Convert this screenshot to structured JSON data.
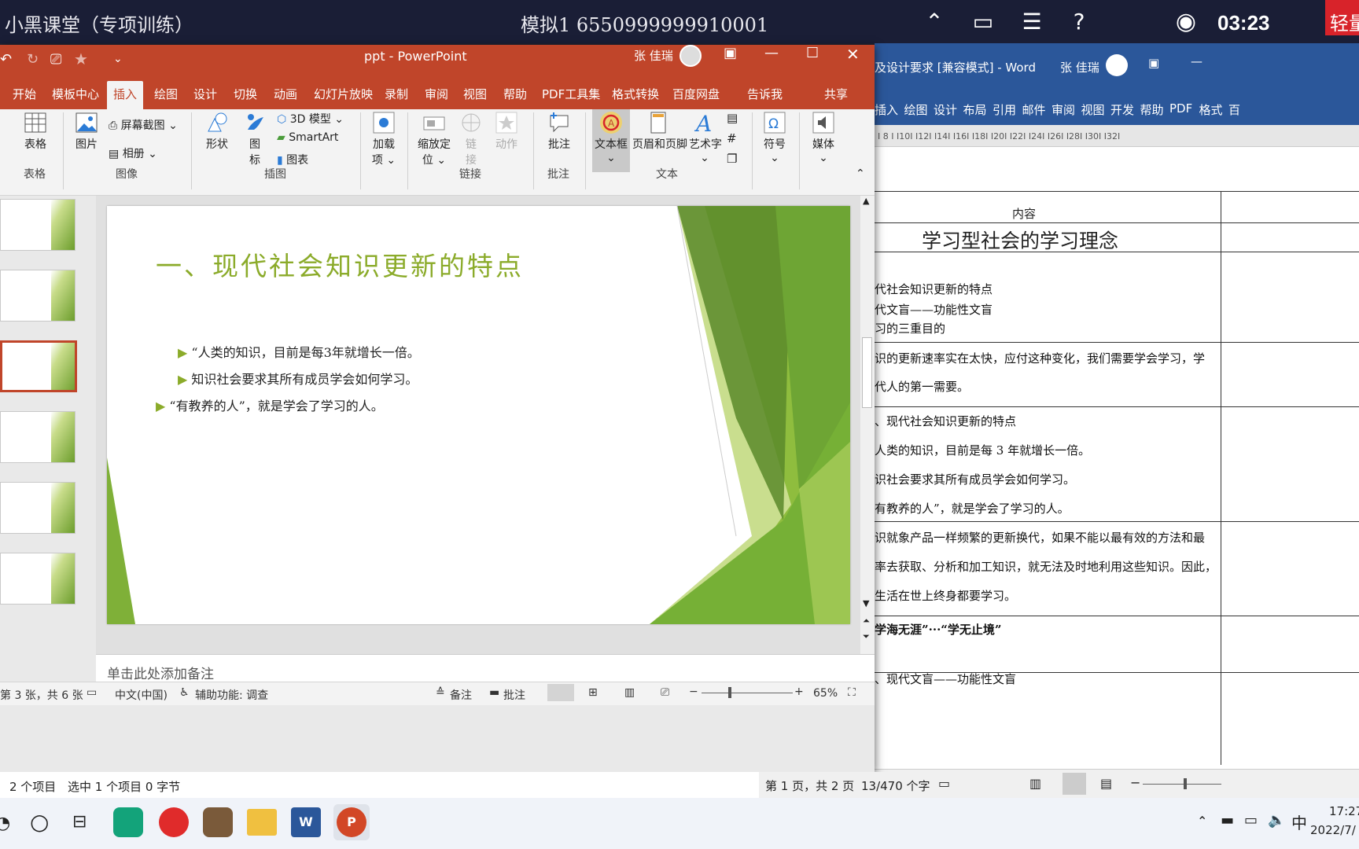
{
  "topbar": {
    "title": "小黑课堂（专项训练）",
    "exam": "模拟1  6550999999910001",
    "clock": "03:23",
    "badge": "轻量"
  },
  "word": {
    "title": "及设计要求 [兼容模式] - Word",
    "user": "张 佳瑞",
    "tabs": [
      "插入",
      "绘图",
      "设计",
      "布局",
      "引用",
      "邮件",
      "审阅",
      "视图",
      "开发",
      "帮助",
      "PDF",
      "格式",
      "百"
    ],
    "ruler": "I 8 I   I10I   I12I   I14I   I16I   I18I   I20I   I22I   I24I   I26I   I28I   I30I   I32I",
    "header_col": "内容",
    "heading": "学习型社会的学习理念",
    "lines": [
      "代社会知识更新的特点",
      "代文盲——功能性文盲",
      "习的三重目的",
      "识的更新速率实在太快，应付这种变化，我们需要学会学习，学",
      "代人的第一需要。",
      "、现代社会知识更新的特点",
      "人类的知识，目前是每 3 年就增长一倍。",
      "识社会要求其所有成员学会如何学习。",
      "有教养的人”，就是学会了学习的人。",
      "识就象产品一样频繁的更新换代，如果不能以最有效的方法和最",
      "率去获取、分析和加工知识，就无法及时地利用这些知识。因此，",
      "生活在世上终身都要学习。",
      "学海无涯”···“学无止境”",
      "、现代文盲——功能性文盲"
    ],
    "status_page": "第 1 页，共 2 页",
    "status_words": "13/470 个字"
  },
  "ppt": {
    "title": "ppt  -  PowerPoint",
    "user": "张 佳瑞",
    "tabs": [
      "开始",
      "模板中心",
      "插入",
      "绘图",
      "设计",
      "切换",
      "动画",
      "幻灯片放映",
      "录制",
      "审阅",
      "视图",
      "帮助",
      "PDF工具集",
      "格式转换",
      "百度网盘",
      "告诉我",
      "共享"
    ],
    "ribbon": {
      "table": "表格",
      "picture": "图片",
      "screenshot": "屏幕截图",
      "album": "相册",
      "shapes": "形状",
      "icons_l1": "图",
      "icons_l2": "标",
      "model3d": "3D 模型",
      "smartart": "SmartArt",
      "chart": "图表",
      "addin_l1": "加载",
      "addin_l2": "项",
      "zoom_l1": "缩放定",
      "zoom_l2": "位",
      "link_l1": "链",
      "link_l2": "接",
      "action": "动作",
      "comment": "批注",
      "textbox": "文本框",
      "headerfooter": "页眉和页脚",
      "wordart": "艺术字",
      "symbol": "符号",
      "media": "媒体"
    },
    "groups": {
      "table": "表格",
      "image": "图像",
      "illustration": "插图",
      "link": "链接",
      "comment": "批注",
      "text": "文本"
    },
    "slide": {
      "title": "一、现代社会知识更新的特点",
      "bullets": [
        "“人类的知识，目前是每3年就增长一倍。",
        "知识社会要求其所有成员学会如何学习。",
        "“有教养的人”，就是学会了学习的人。"
      ]
    },
    "notes": "单击此处添加备注",
    "status": {
      "slide": "第 3 张，共 6 张",
      "lang": "中文(中国)",
      "access": "辅助功能: 调查",
      "notes": "备注",
      "comments": "批注",
      "zoom": "65%"
    }
  },
  "explorer": {
    "items": "2 个项目",
    "selected": "选中 1 个项目  0 字节"
  },
  "taskbar": {
    "time": "17:27",
    "date": "2022/7/",
    "ime": "中"
  },
  "colors": {
    "ppt": "#c0452a",
    "word": "#2b579a",
    "slide_title": "#8bab2a"
  }
}
